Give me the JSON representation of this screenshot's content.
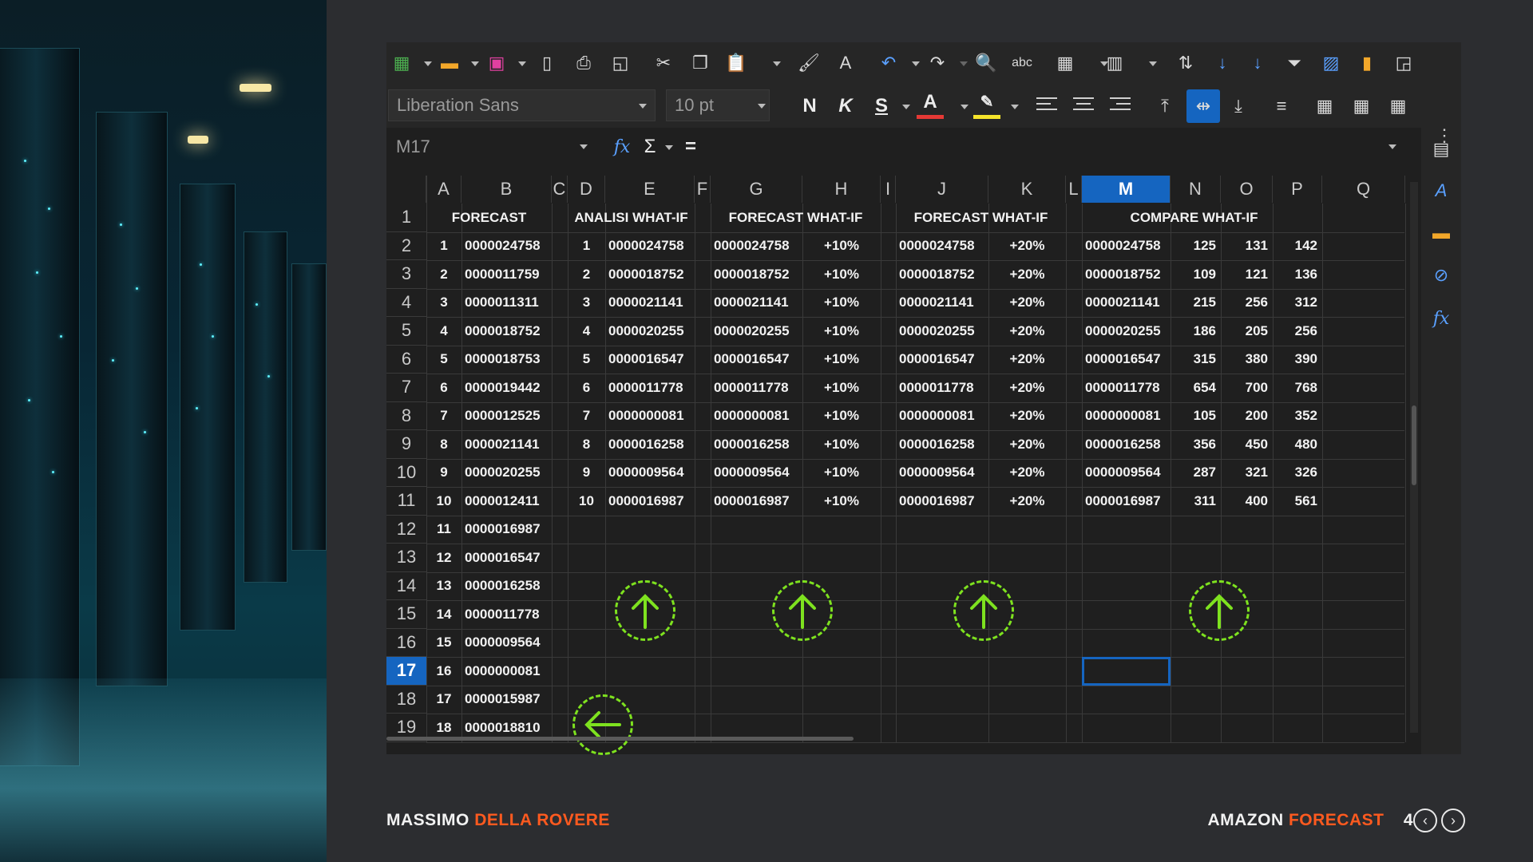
{
  "toolbar": {
    "font_name": "Liberation Sans",
    "font_size": "10 pt",
    "bold_label": "N",
    "italic_label": "K",
    "underline_label": "S",
    "font_color_label": "A"
  },
  "formula_bar": {
    "name_box": "M17",
    "fx_symbol": "fx",
    "sum_symbol": "Σ",
    "equals_symbol": "="
  },
  "columns": [
    "A",
    "B",
    "C",
    "D",
    "E",
    "F",
    "G",
    "H",
    "I",
    "J",
    "K",
    "L",
    "M",
    "N",
    "O",
    "P",
    "Q"
  ],
  "selected_column": "M",
  "rows": [
    "1",
    "2",
    "3",
    "4",
    "5",
    "6",
    "7",
    "8",
    "9",
    "10",
    "11",
    "12",
    "13",
    "14",
    "15",
    "16",
    "17",
    "18",
    "19"
  ],
  "selected_row": "17",
  "headers": {
    "forecast": "FORECAST",
    "analisi": "ANALISI WHAT-IF",
    "forecast_whatif_1": "FORECAST WHAT-IF",
    "forecast_whatif_2": "FORECAST WHAT-IF",
    "compare": "COMPARE WHAT-IF"
  },
  "col_a": [
    "1",
    "2",
    "3",
    "4",
    "5",
    "6",
    "7",
    "8",
    "9",
    "10",
    "11",
    "12",
    "13",
    "14",
    "15",
    "16",
    "17",
    "18"
  ],
  "col_b": [
    "0000024758",
    "0000011759",
    "0000011311",
    "0000018752",
    "0000018753",
    "0000019442",
    "0000012525",
    "0000021141",
    "0000020255",
    "0000012411",
    "0000016987",
    "0000016547",
    "0000016258",
    "0000011778",
    "0000009564",
    "0000000081",
    "0000015987",
    "0000018810"
  ],
  "col_d": [
    "1",
    "2",
    "3",
    "4",
    "5",
    "6",
    "7",
    "8",
    "9",
    "10"
  ],
  "col_e": [
    "0000024758",
    "0000018752",
    "0000021141",
    "0000020255",
    "0000016547",
    "0000011778",
    "0000000081",
    "0000016258",
    "0000009564",
    "0000016987"
  ],
  "col_g": [
    "0000024758",
    "0000018752",
    "0000021141",
    "0000020255",
    "0000016547",
    "0000011778",
    "0000000081",
    "0000016258",
    "0000009564",
    "0000016987"
  ],
  "col_h": [
    "+10%",
    "+10%",
    "+10%",
    "+10%",
    "+10%",
    "+10%",
    "+10%",
    "+10%",
    "+10%",
    "+10%"
  ],
  "col_j": [
    "0000024758",
    "0000018752",
    "0000021141",
    "0000020255",
    "0000016547",
    "0000011778",
    "0000000081",
    "0000016258",
    "0000009564",
    "0000016987"
  ],
  "col_k": [
    "+20%",
    "+20%",
    "+20%",
    "+20%",
    "+20%",
    "+20%",
    "+20%",
    "+20%",
    "+20%",
    "+20%"
  ],
  "col_m": [
    "0000024758",
    "0000018752",
    "0000021141",
    "0000020255",
    "0000016547",
    "0000011778",
    "0000000081",
    "0000016258",
    "0000009564",
    "0000016987"
  ],
  "col_n": [
    "125",
    "109",
    "215",
    "186",
    "315",
    "654",
    "105",
    "356",
    "287",
    "311"
  ],
  "col_o": [
    "131",
    "121",
    "256",
    "205",
    "380",
    "700",
    "200",
    "450",
    "321",
    "400"
  ],
  "col_p": [
    "142",
    "136",
    "312",
    "256",
    "390",
    "768",
    "352",
    "480",
    "326",
    "561"
  ],
  "footer": {
    "author_first": "MASSIMO",
    "author_last": "DELLA ROVERE",
    "title_first": "AMAZON",
    "title_second": "FORECAST",
    "page_number": "4"
  },
  "colors": {
    "accent": "#ff5a1f",
    "selection": "#1565c0",
    "arrow": "#7ee21f"
  }
}
